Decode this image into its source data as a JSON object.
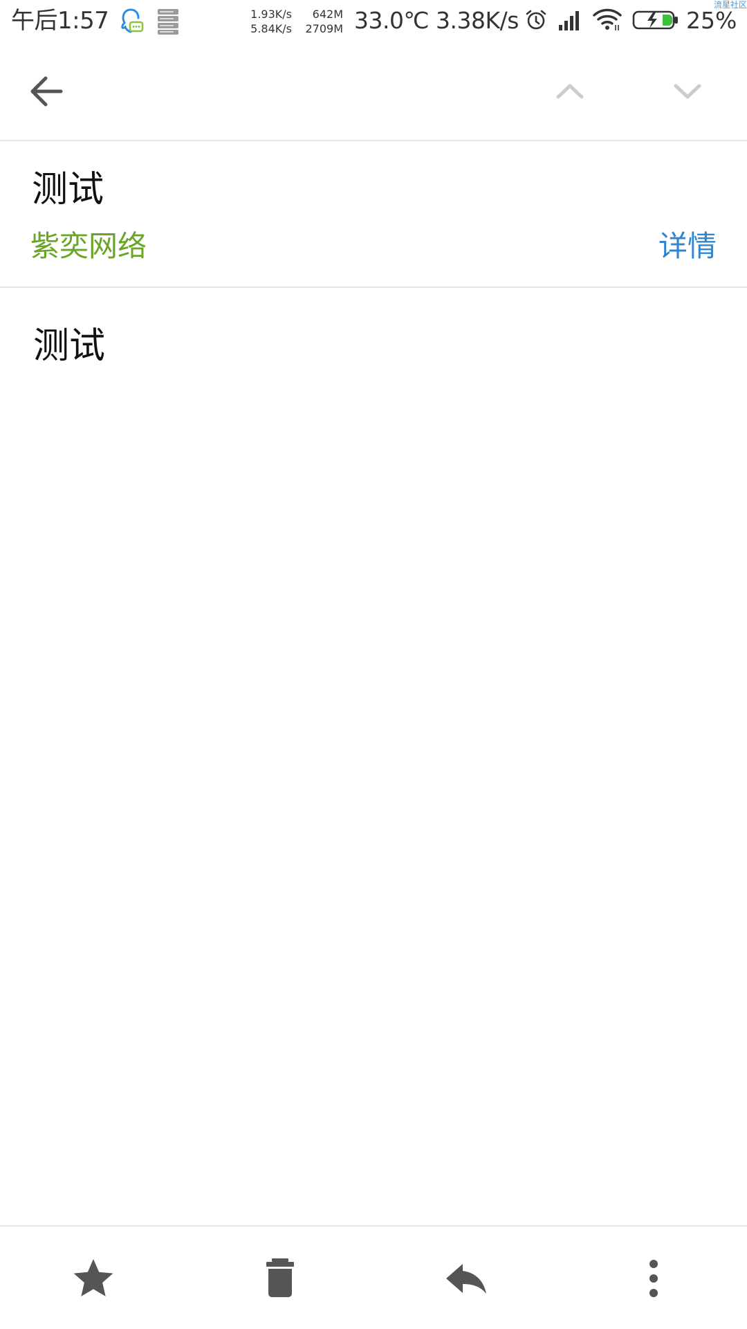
{
  "status_bar": {
    "time": "午后1:57",
    "net_up": "1.93K/s",
    "net_down": "5.84K/s",
    "mem_used": "642M",
    "mem_total": "2709M",
    "temperature": "33.0℃",
    "speed": "3.38K/s",
    "battery_percent": "25%",
    "corner_label": "流星社区",
    "icons": [
      "qq-icon",
      "server-icon",
      "alarm-icon",
      "signal-icon",
      "wifi-icon",
      "battery-charging-icon"
    ]
  },
  "toolbar": {
    "icons": [
      "back-arrow-icon",
      "chevron-up-icon",
      "chevron-down-icon"
    ]
  },
  "message": {
    "subject": "测试",
    "sender": "紫奕网络",
    "details_label": "详情",
    "body": "测试"
  },
  "bottom_bar": {
    "icons": [
      "star-icon",
      "trash-icon",
      "reply-icon",
      "more-vert-icon"
    ]
  },
  "colors": {
    "sender": "#6aa52a",
    "details_link": "#2f86cf",
    "icon_dark": "#555555",
    "icon_disabled": "#cccccc",
    "divider": "#e6e6e6"
  }
}
